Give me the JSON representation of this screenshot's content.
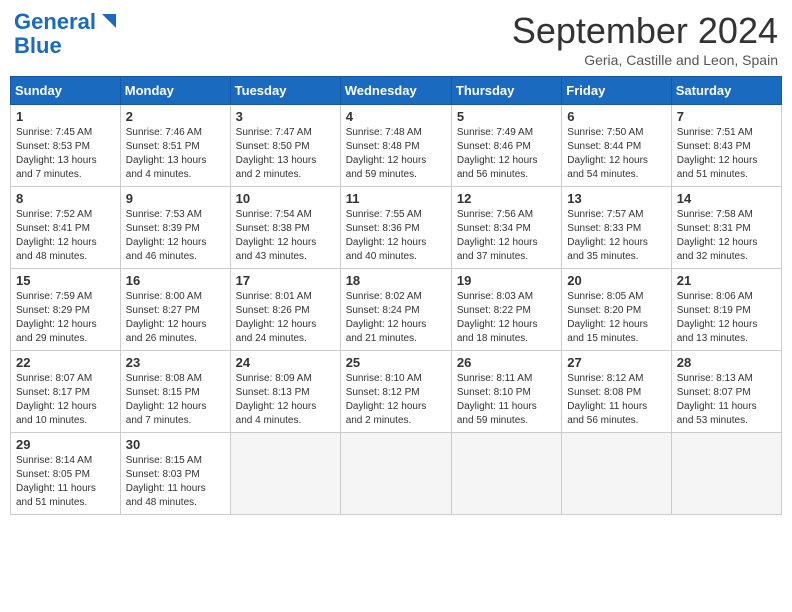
{
  "header": {
    "logo_line1": "General",
    "logo_line2": "Blue",
    "month_title": "September 2024",
    "location": "Geria, Castille and Leon, Spain"
  },
  "weekdays": [
    "Sunday",
    "Monday",
    "Tuesday",
    "Wednesday",
    "Thursday",
    "Friday",
    "Saturday"
  ],
  "weeks": [
    [
      {
        "day": "1",
        "text": "Sunrise: 7:45 AM\nSunset: 8:53 PM\nDaylight: 13 hours\nand 7 minutes."
      },
      {
        "day": "2",
        "text": "Sunrise: 7:46 AM\nSunset: 8:51 PM\nDaylight: 13 hours\nand 4 minutes."
      },
      {
        "day": "3",
        "text": "Sunrise: 7:47 AM\nSunset: 8:50 PM\nDaylight: 13 hours\nand 2 minutes."
      },
      {
        "day": "4",
        "text": "Sunrise: 7:48 AM\nSunset: 8:48 PM\nDaylight: 12 hours\nand 59 minutes."
      },
      {
        "day": "5",
        "text": "Sunrise: 7:49 AM\nSunset: 8:46 PM\nDaylight: 12 hours\nand 56 minutes."
      },
      {
        "day": "6",
        "text": "Sunrise: 7:50 AM\nSunset: 8:44 PM\nDaylight: 12 hours\nand 54 minutes."
      },
      {
        "day": "7",
        "text": "Sunrise: 7:51 AM\nSunset: 8:43 PM\nDaylight: 12 hours\nand 51 minutes."
      }
    ],
    [
      {
        "day": "8",
        "text": "Sunrise: 7:52 AM\nSunset: 8:41 PM\nDaylight: 12 hours\nand 48 minutes."
      },
      {
        "day": "9",
        "text": "Sunrise: 7:53 AM\nSunset: 8:39 PM\nDaylight: 12 hours\nand 46 minutes."
      },
      {
        "day": "10",
        "text": "Sunrise: 7:54 AM\nSunset: 8:38 PM\nDaylight: 12 hours\nand 43 minutes."
      },
      {
        "day": "11",
        "text": "Sunrise: 7:55 AM\nSunset: 8:36 PM\nDaylight: 12 hours\nand 40 minutes."
      },
      {
        "day": "12",
        "text": "Sunrise: 7:56 AM\nSunset: 8:34 PM\nDaylight: 12 hours\nand 37 minutes."
      },
      {
        "day": "13",
        "text": "Sunrise: 7:57 AM\nSunset: 8:33 PM\nDaylight: 12 hours\nand 35 minutes."
      },
      {
        "day": "14",
        "text": "Sunrise: 7:58 AM\nSunset: 8:31 PM\nDaylight: 12 hours\nand 32 minutes."
      }
    ],
    [
      {
        "day": "15",
        "text": "Sunrise: 7:59 AM\nSunset: 8:29 PM\nDaylight: 12 hours\nand 29 minutes."
      },
      {
        "day": "16",
        "text": "Sunrise: 8:00 AM\nSunset: 8:27 PM\nDaylight: 12 hours\nand 26 minutes."
      },
      {
        "day": "17",
        "text": "Sunrise: 8:01 AM\nSunset: 8:26 PM\nDaylight: 12 hours\nand 24 minutes."
      },
      {
        "day": "18",
        "text": "Sunrise: 8:02 AM\nSunset: 8:24 PM\nDaylight: 12 hours\nand 21 minutes."
      },
      {
        "day": "19",
        "text": "Sunrise: 8:03 AM\nSunset: 8:22 PM\nDaylight: 12 hours\nand 18 minutes."
      },
      {
        "day": "20",
        "text": "Sunrise: 8:05 AM\nSunset: 8:20 PM\nDaylight: 12 hours\nand 15 minutes."
      },
      {
        "day": "21",
        "text": "Sunrise: 8:06 AM\nSunset: 8:19 PM\nDaylight: 12 hours\nand 13 minutes."
      }
    ],
    [
      {
        "day": "22",
        "text": "Sunrise: 8:07 AM\nSunset: 8:17 PM\nDaylight: 12 hours\nand 10 minutes."
      },
      {
        "day": "23",
        "text": "Sunrise: 8:08 AM\nSunset: 8:15 PM\nDaylight: 12 hours\nand 7 minutes."
      },
      {
        "day": "24",
        "text": "Sunrise: 8:09 AM\nSunset: 8:13 PM\nDaylight: 12 hours\nand 4 minutes."
      },
      {
        "day": "25",
        "text": "Sunrise: 8:10 AM\nSunset: 8:12 PM\nDaylight: 12 hours\nand 2 minutes."
      },
      {
        "day": "26",
        "text": "Sunrise: 8:11 AM\nSunset: 8:10 PM\nDaylight: 11 hours\nand 59 minutes."
      },
      {
        "day": "27",
        "text": "Sunrise: 8:12 AM\nSunset: 8:08 PM\nDaylight: 11 hours\nand 56 minutes."
      },
      {
        "day": "28",
        "text": "Sunrise: 8:13 AM\nSunset: 8:07 PM\nDaylight: 11 hours\nand 53 minutes."
      }
    ],
    [
      {
        "day": "29",
        "text": "Sunrise: 8:14 AM\nSunset: 8:05 PM\nDaylight: 11 hours\nand 51 minutes."
      },
      {
        "day": "30",
        "text": "Sunrise: 8:15 AM\nSunset: 8:03 PM\nDaylight: 11 hours\nand 48 minutes."
      },
      null,
      null,
      null,
      null,
      null
    ]
  ]
}
